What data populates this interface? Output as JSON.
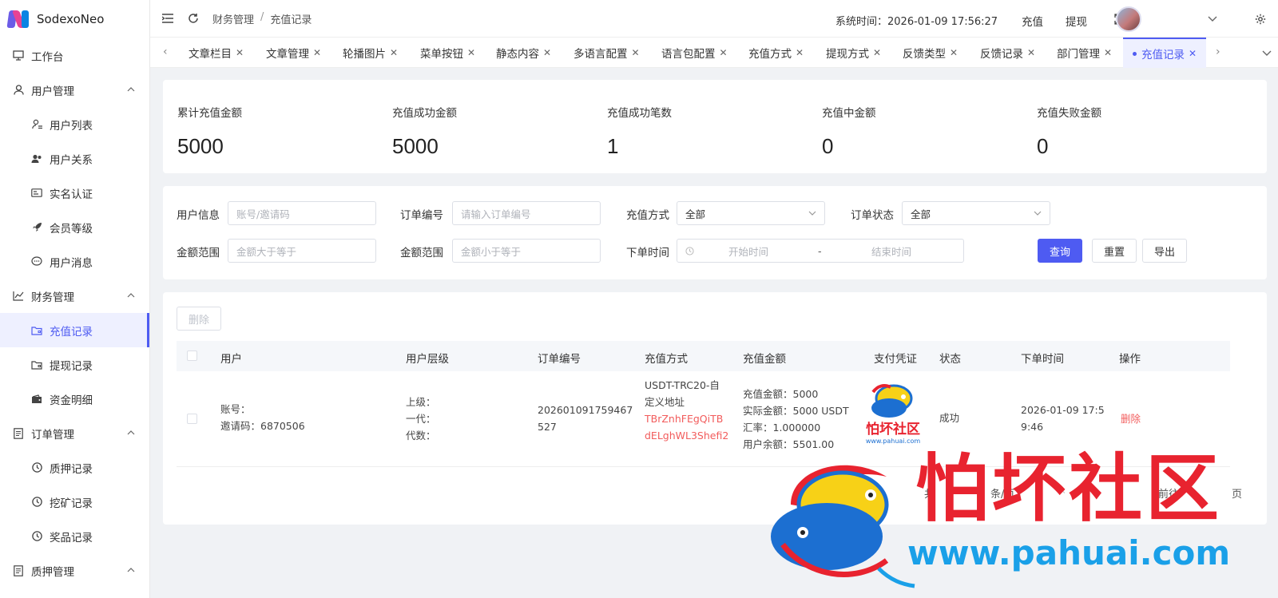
{
  "app": {
    "name": "SodexoNeo"
  },
  "sidebar": {
    "items": [
      {
        "label": "工作台",
        "icon": "monitor-icon",
        "level": 0
      },
      {
        "label": "用户管理",
        "icon": "user-icon",
        "level": 0,
        "expanded": true
      },
      {
        "label": "用户列表",
        "icon": "user-list-icon",
        "level": 1
      },
      {
        "label": "用户关系",
        "icon": "users-icon",
        "level": 1
      },
      {
        "label": "实名认证",
        "icon": "id-card-icon",
        "level": 1
      },
      {
        "label": "会员等级",
        "icon": "rocket-icon",
        "level": 1
      },
      {
        "label": "用户消息",
        "icon": "chat-icon",
        "level": 1
      },
      {
        "label": "财务管理",
        "icon": "chart-icon",
        "level": 0,
        "expanded": true
      },
      {
        "label": "充值记录",
        "icon": "folder-icon",
        "level": 1,
        "active": true
      },
      {
        "label": "提现记录",
        "icon": "folder-icon",
        "level": 1
      },
      {
        "label": "资金明细",
        "icon": "wallet-icon",
        "level": 1
      },
      {
        "label": "订单管理",
        "icon": "document-icon",
        "level": 0,
        "expanded": true
      },
      {
        "label": "质押记录",
        "icon": "clock-icon",
        "level": 1
      },
      {
        "label": "挖矿记录",
        "icon": "clock-icon",
        "level": 1
      },
      {
        "label": "奖品记录",
        "icon": "clock-icon",
        "level": 1
      },
      {
        "label": "质押管理",
        "icon": "document-icon",
        "level": 0,
        "expanded": true
      }
    ]
  },
  "header": {
    "breadcrumb": [
      "财务管理",
      "充值记录"
    ],
    "breadcrumb_sep": "/",
    "system_time": "系统时间：2026-01-09 17:56:27",
    "recharge_label": "充值",
    "withdraw_label": "提现"
  },
  "tabs": [
    {
      "label": "文章栏目"
    },
    {
      "label": "文章管理"
    },
    {
      "label": "轮播图片"
    },
    {
      "label": "菜单按钮"
    },
    {
      "label": "静态内容"
    },
    {
      "label": "多语言配置"
    },
    {
      "label": "语言包配置"
    },
    {
      "label": "充值方式"
    },
    {
      "label": "提现方式"
    },
    {
      "label": "反馈类型"
    },
    {
      "label": "反馈记录"
    },
    {
      "label": "部门管理"
    },
    {
      "label": "充值记录",
      "active": true
    }
  ],
  "stats": [
    {
      "label": "累计充值金额",
      "value": "5000"
    },
    {
      "label": "充值成功金额",
      "value": "5000"
    },
    {
      "label": "充值成功笔数",
      "value": "1"
    },
    {
      "label": "充值中金额",
      "value": "0"
    },
    {
      "label": "充值失败金额",
      "value": "0"
    }
  ],
  "filters": {
    "user_info_label": "用户信息",
    "user_info_placeholder": "账号/邀请码",
    "order_no_label": "订单编号",
    "order_no_placeholder": "请输入订单编号",
    "method_label": "充值方式",
    "method_value": "全部",
    "status_label": "订单状态",
    "status_value": "全部",
    "amount_min_label": "金额范围",
    "amount_min_placeholder": "金额大于等于",
    "amount_max_label": "金额范围",
    "amount_max_placeholder": "金额小于等于",
    "time_label": "下单时间",
    "time_start_placeholder": "开始时间",
    "time_sep": "-",
    "time_end_placeholder": "结束时间",
    "query_label": "查询",
    "reset_label": "重置",
    "export_label": "导出"
  },
  "table": {
    "delete_button": "删除",
    "columns": [
      "用户",
      "用户层级",
      "订单编号",
      "充值方式",
      "充值金额",
      "支付凭证",
      "状态",
      "下单时间",
      "操作"
    ],
    "row": {
      "user_account": "账号：",
      "user_invite": "邀请码：6870506",
      "level_upper": "上级：",
      "level_first": "一代：",
      "level_gen": "代数：",
      "order_no_1": "202601091759467",
      "order_no_2": "527",
      "method_1": "USDT-TRC20-自",
      "method_2": "定义地址",
      "address_1": "TBrZnhFEgQiTB",
      "address_2": "dELghWL3Shefi2",
      "amount_1": "充值金额：5000",
      "amount_2": "实际金额：5000 USDT",
      "amount_3": "汇率：1.000000",
      "amount_4": "用户余额：5501.00",
      "status": "成功",
      "time_1": "2026-01-09 17:5",
      "time_2": "9:46",
      "action": "删除"
    },
    "pager_total": "共",
    "pager_size": "条/页",
    "pager_goto": "前往",
    "pager_page": "页"
  },
  "watermark": {
    "text": "怕坏社区",
    "url": "www.pahuai.com"
  },
  "colors": {
    "accent": "#4e5bf2",
    "danger": "#f25c5c",
    "watermark_red": "#e8232f",
    "watermark_blue": "#1aa0e8"
  }
}
